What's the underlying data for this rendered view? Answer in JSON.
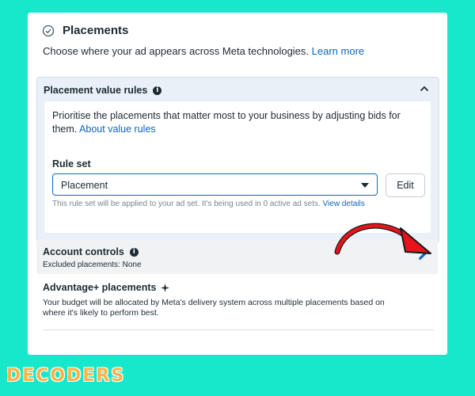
{
  "placements": {
    "title": "Placements",
    "subtitle": "Choose where your ad appears across Meta technologies.",
    "learn_more": "Learn more"
  },
  "value_rules": {
    "title": "Placement value rules",
    "description": "Prioritise the placements that matter most to your business by adjusting bids for them.",
    "about_link": "About value rules",
    "rule_set_label": "Rule set",
    "rule_set_value": "Placement",
    "edit_label": "Edit",
    "helper_text": "This rule set will be applied to your ad set. It's being used in 0 active ad sets.",
    "view_details": "View details"
  },
  "account_controls": {
    "title": "Account controls",
    "excluded": "Excluded placements: None"
  },
  "advantage": {
    "title": "Advantage+ placements",
    "description": "Your budget will be allocated by Meta's delivery system across multiple placements based on where it's likely to perform best."
  },
  "brand": {
    "logo_text": "DECODERS"
  },
  "colors": {
    "background": "#17e8cc",
    "link": "#0a66c2",
    "arrow": "#e8141c",
    "logo": "#ffb24a"
  }
}
